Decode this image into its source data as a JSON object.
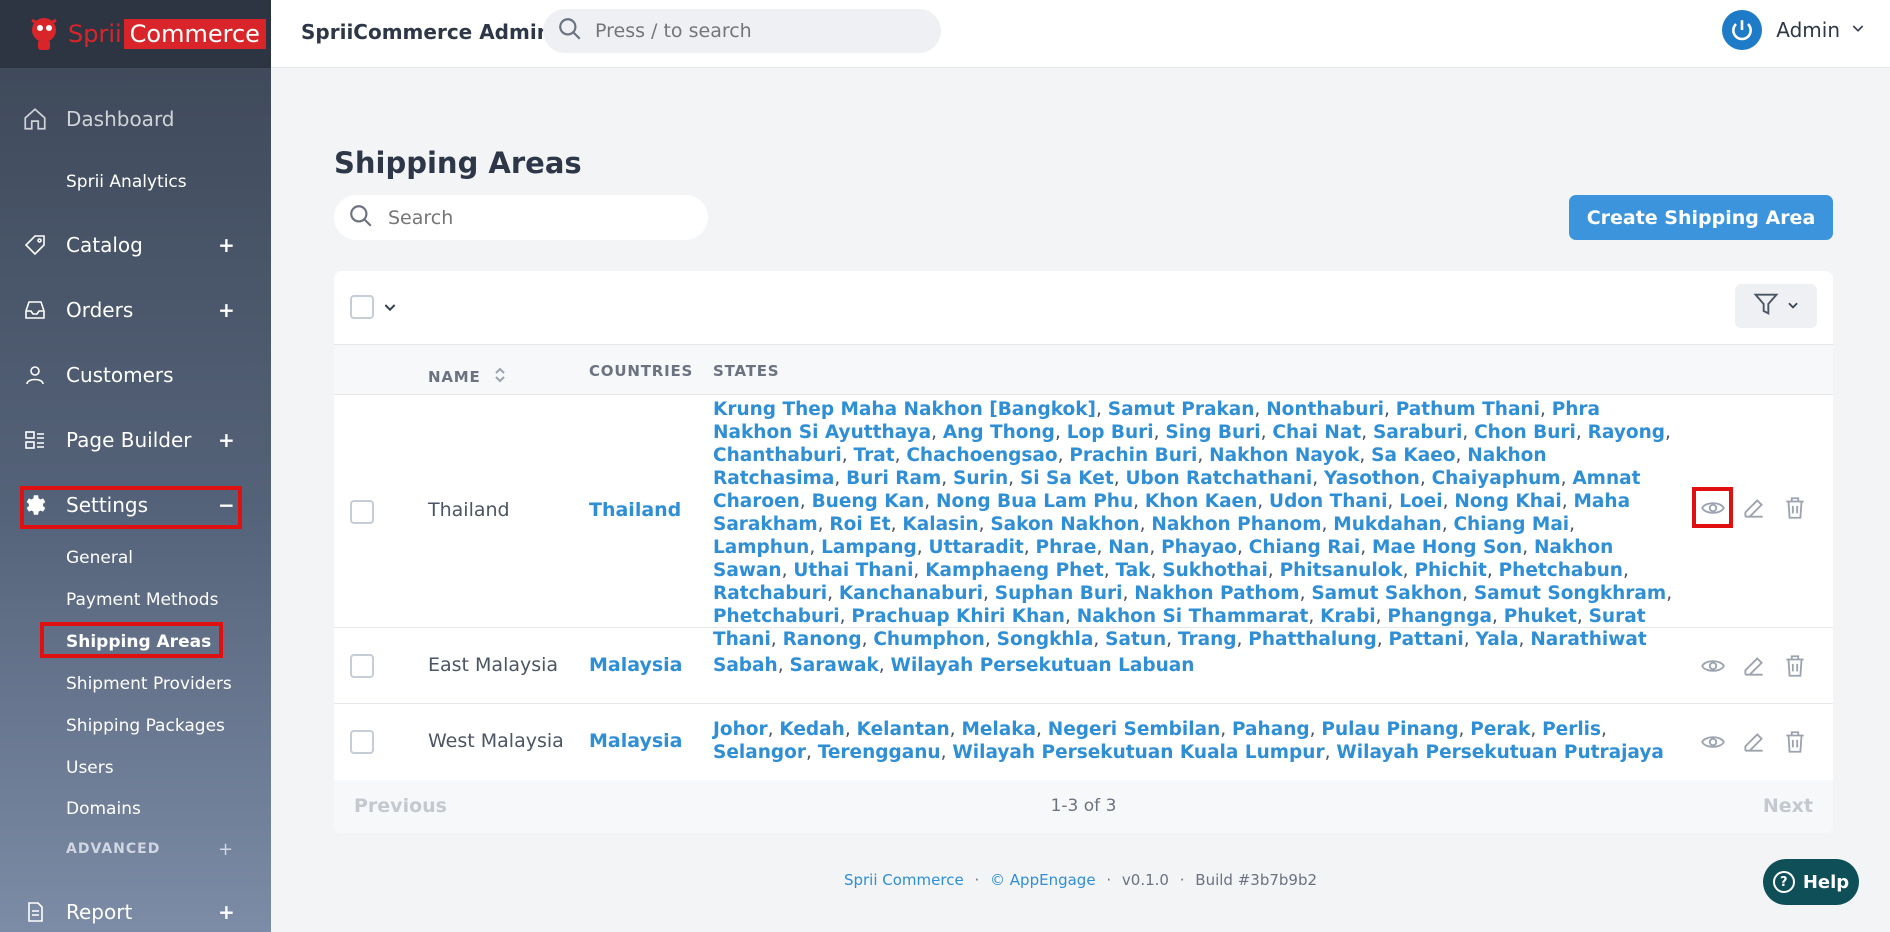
{
  "logo": {
    "part1": "Sprii",
    "part2": "Commerce"
  },
  "topbar": {
    "app_title": "SpriiCommerce Admin",
    "search_placeholder": "Press / to search",
    "user": "Admin"
  },
  "sidebar": {
    "dashboard": "Dashboard",
    "analytics": "Sprii Analytics",
    "catalog": "Catalog",
    "orders": "Orders",
    "customers": "Customers",
    "page_builder": "Page Builder",
    "settings": "Settings",
    "settings_items": [
      "General",
      "Payment Methods",
      "Shipping Areas",
      "Shipment Providers",
      "Shipping Packages",
      "Users",
      "Domains"
    ],
    "advanced": "ADVANCED",
    "report": "Report",
    "plus": "+",
    "minus": "−"
  },
  "page": {
    "title": "Shipping Areas",
    "search_placeholder": "Search",
    "create_button": "Create Shipping Area"
  },
  "table": {
    "headers": {
      "name": "NAME",
      "countries": "COUNTRIES",
      "states": "STATES"
    },
    "rows": [
      {
        "name": "Thailand",
        "country": "Thailand",
        "states": [
          "Krung Thep Maha Nakhon [Bangkok]",
          "Samut Prakan",
          "Nonthaburi",
          "Pathum Thani",
          "Phra Nakhon Si Ayutthaya",
          "Ang Thong",
          "Lop Buri",
          "Sing Buri",
          "Chai Nat",
          "Saraburi",
          "Chon Buri",
          "Rayong",
          "Chanthaburi",
          "Trat",
          "Chachoengsao",
          "Prachin Buri",
          "Nakhon Nayok",
          "Sa Kaeo",
          "Nakhon Ratchasima",
          "Buri Ram",
          "Surin",
          "Si Sa Ket",
          "Ubon Ratchathani",
          "Yasothon",
          "Chaiyaphum",
          "Amnat Charoen",
          "Bueng Kan",
          "Nong Bua Lam Phu",
          "Khon Kaen",
          "Udon Thani",
          "Loei",
          "Nong Khai",
          "Maha Sarakham",
          "Roi Et",
          "Kalasin",
          "Sakon Nakhon",
          "Nakhon Phanom",
          "Mukdahan",
          "Chiang Mai",
          "Lamphun",
          "Lampang",
          "Uttaradit",
          "Phrae",
          "Nan",
          "Phayao",
          "Chiang Rai",
          "Mae Hong Son",
          "Nakhon Sawan",
          "Uthai Thani",
          "Kamphaeng Phet",
          "Tak",
          "Sukhothai",
          "Phitsanulok",
          "Phichit",
          "Phetchabun",
          "Ratchaburi",
          "Kanchanaburi",
          "Suphan Buri",
          "Nakhon Pathom",
          "Samut Sakhon",
          "Samut Songkhram",
          "Phetchaburi",
          "Prachuap Khiri Khan",
          "Nakhon Si Thammarat",
          "Krabi",
          "Phangnga",
          "Phuket",
          "Surat Thani",
          "Ranong",
          "Chumphon",
          "Songkhla",
          "Satun",
          "Trang",
          "Phatthalung",
          "Pattani",
          "Yala",
          "Narathiwat"
        ]
      },
      {
        "name": "East Malaysia",
        "country": "Malaysia",
        "states": [
          "Sabah",
          "Sarawak",
          "Wilayah Persekutuan Labuan"
        ]
      },
      {
        "name": "West Malaysia",
        "country": "Malaysia",
        "states": [
          "Johor",
          "Kedah",
          "Kelantan",
          "Melaka",
          "Negeri Sembilan",
          "Pahang",
          "Pulau Pinang",
          "Perak",
          "Perlis",
          "Selangor",
          "Terengganu",
          "Wilayah Persekutuan Kuala Lumpur",
          "Wilayah Persekutuan Putrajaya"
        ]
      }
    ]
  },
  "pagination": {
    "previous": "Previous",
    "info": "1-3 of 3",
    "next": "Next"
  },
  "footer": {
    "brand": "Sprii Commerce",
    "copyright": "© AppEngage",
    "version": "v0.1.0",
    "build": "Build #3b7b9b2",
    "sep": "·"
  },
  "help": "Help",
  "colors": {
    "accent": "#3b94dc",
    "link": "#2e8fd6",
    "highlight": "#e01010"
  }
}
